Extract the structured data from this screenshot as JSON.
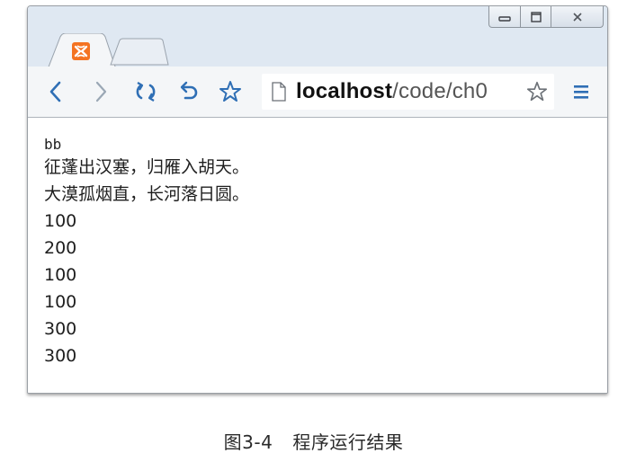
{
  "window": {
    "controls": {
      "minimize_icon": "minimize-icon",
      "maximize_icon": "maximize-icon",
      "close_icon": "close-icon"
    },
    "tab_icon": "xampp-logo-icon"
  },
  "toolbar": {
    "back_icon": "chevron-left-icon",
    "forward_icon": "chevron-right-icon",
    "reload_icon": "reload-icon",
    "undo_icon": "undo-icon",
    "star_icon": "star-icon",
    "menu_icon": "hamburger-menu-icon",
    "url": {
      "host": "localhost",
      "path": "/code/ch0"
    },
    "accent": "#2f6fb5"
  },
  "page": {
    "lines": [
      "bb",
      "征蓬出汉塞，归雁入胡天。",
      "大漠孤烟直，长河落日圆。",
      "100",
      "200",
      "100",
      "100",
      "300",
      "300"
    ]
  },
  "caption": {
    "figure": "图3-4",
    "title": "程序运行结果"
  }
}
